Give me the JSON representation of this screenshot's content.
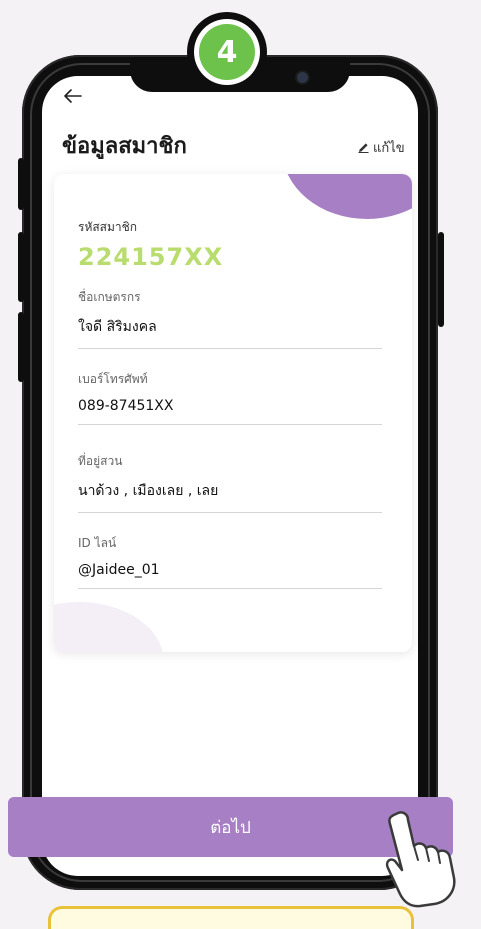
{
  "step": {
    "number": "4"
  },
  "header": {
    "back_icon": "arrow-left-icon",
    "title": "ข้อมูลสมาชิก",
    "edit_icon": "pencil-icon",
    "edit_label": "แก้ไข"
  },
  "member": {
    "id_label": "รหัสสมาชิก",
    "id_value": "224157XX"
  },
  "fields": [
    {
      "label": "ชื่อเกษตรกร",
      "value": "ใจดี สิริมงคล"
    },
    {
      "label": "เบอร์โทรศัพท์",
      "value": "089-87451XX"
    },
    {
      "label": "ที่อยู่สวน",
      "value": "นาด้วง , เมืองเลย , เลย"
    },
    {
      "label": "ID ไลน์",
      "value": "@Jaidee_01"
    }
  ],
  "actions": {
    "next_label": "ต่อไป"
  },
  "colors": {
    "accent": "#a77fc4",
    "member_id": "#b9dc6e",
    "step_badge": "#6cc24a"
  }
}
